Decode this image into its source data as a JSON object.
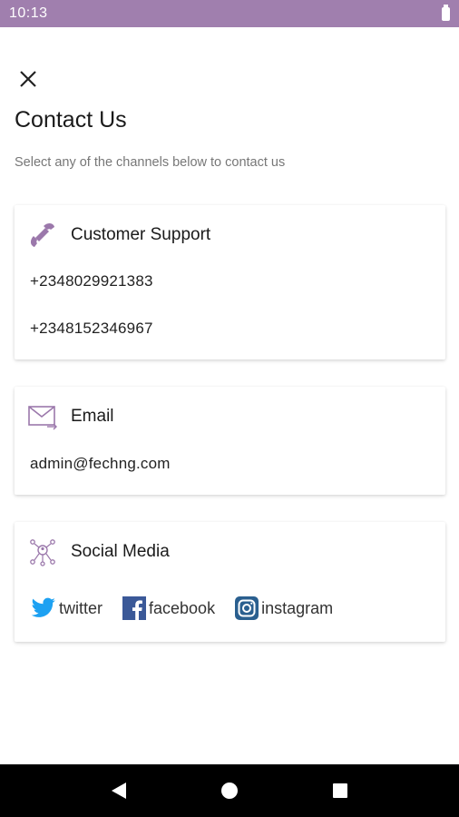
{
  "status_bar": {
    "time": "10:13"
  },
  "header": {
    "title": "Contact Us",
    "subtitle": "Select any of the channels below to contact us"
  },
  "cards": {
    "support": {
      "title": "Customer Support",
      "phones": [
        "+2348029921383",
        "+2348152346967"
      ]
    },
    "email": {
      "title": "Email",
      "address": "admin@fechng.com"
    },
    "social": {
      "title": "Social Media",
      "links": [
        {
          "label": "twitter",
          "icon": "twitter-icon"
        },
        {
          "label": "facebook",
          "icon": "facebook-icon"
        },
        {
          "label": "instagram",
          "icon": "instagram-icon"
        }
      ]
    }
  },
  "colors": {
    "accent": "#a07fae",
    "twitter": "#1da1f2",
    "facebook": "#3b5998",
    "instagram": "#2a5f8f"
  }
}
